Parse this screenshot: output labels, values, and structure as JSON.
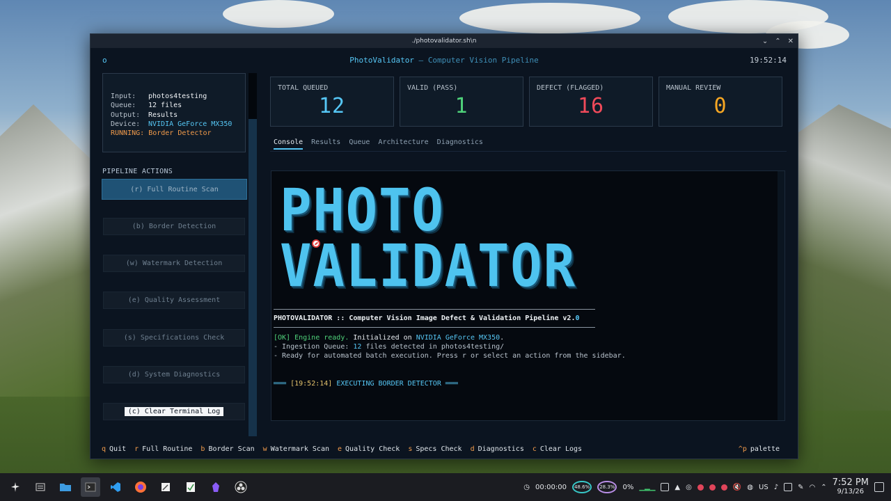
{
  "window": {
    "title": "./photovalidator.sh\\n"
  },
  "header": {
    "indicator": "o",
    "app_name": "PhotoValidator",
    "separator": " — ",
    "subtitle": "Computer Vision Pipeline",
    "clock": "19:52:14"
  },
  "status": {
    "input_label": "Input:",
    "input_value": "photos4testing",
    "queue_label": "Queue:",
    "queue_value": "12 files",
    "output_label": "Output:",
    "output_value": "Results",
    "device_label": "Device:",
    "device_value": "NVIDIA GeForce MX350",
    "running_label": "RUNNING:",
    "running_value": "Border Detector"
  },
  "sidebar": {
    "section_title": "PIPELINE ACTIONS",
    "actions": [
      "(r) Full Routine Scan",
      "(b) Border Detection",
      "(w) Watermark Detection",
      "(e) Quality Assessment",
      "(s) Specifications Check",
      "(d) System Diagnostics",
      "(c) Clear Terminal Log"
    ]
  },
  "stats": [
    {
      "label": "TOTAL QUEUED",
      "value": "12",
      "color": "#56c7f5"
    },
    {
      "label": "VALID (PASS)",
      "value": "1",
      "color": "#4fd27a"
    },
    {
      "label": "DEFECT (FLAGGED)",
      "value": "16",
      "color": "#f04a5a"
    },
    {
      "label": "MANUAL REVIEW",
      "value": "0",
      "color": "#f5a623"
    }
  ],
  "tabs": [
    "Console",
    "Results",
    "Queue",
    "Architecture",
    "Diagnostics"
  ],
  "console": {
    "banner_line1": "PHOTO",
    "banner_line2": "VALIDATOR",
    "heading": "PHOTOVALIDATOR :: Computer Vision Image Defect & Validation Pipeline v2.",
    "heading_ver": "0",
    "ok_tag": "[OK] Engine ready.",
    "ok_mid": " Initialized on ",
    "ok_device": "NVIDIA GeForce MX350",
    "ok_end": ".",
    "ingest_pre": "- Ingestion Queue: ",
    "ingest_count": "12",
    "ingest_post": " files detected in photos4testing/",
    "ready": "- Ready for automated batch execution. Press r or select an action from the sidebar.",
    "exec_pre": "═══ ",
    "exec_ts": "[19:52:14]",
    "exec_post": " EXECUTING BORDER DETECTOR ═══"
  },
  "footer": {
    "items": [
      {
        "key": "q",
        "label": "Quit"
      },
      {
        "key": "r",
        "label": "Full Routine"
      },
      {
        "key": "b",
        "label": "Border Scan"
      },
      {
        "key": "w",
        "label": "Watermark Scan"
      },
      {
        "key": "e",
        "label": "Quality Check"
      },
      {
        "key": "s",
        "label": "Specs Check"
      },
      {
        "key": "d",
        "label": "Diagnostics"
      },
      {
        "key": "c",
        "label": "Clear Logs"
      }
    ],
    "palette_key": "^p",
    "palette_label": "palette"
  },
  "taskbar": {
    "timer": "00:00:00",
    "cpu": "48.6%",
    "mem": "28.3%",
    "percent": "0%",
    "layout": "US",
    "time": "7:52 PM",
    "date": "9/13/26"
  }
}
